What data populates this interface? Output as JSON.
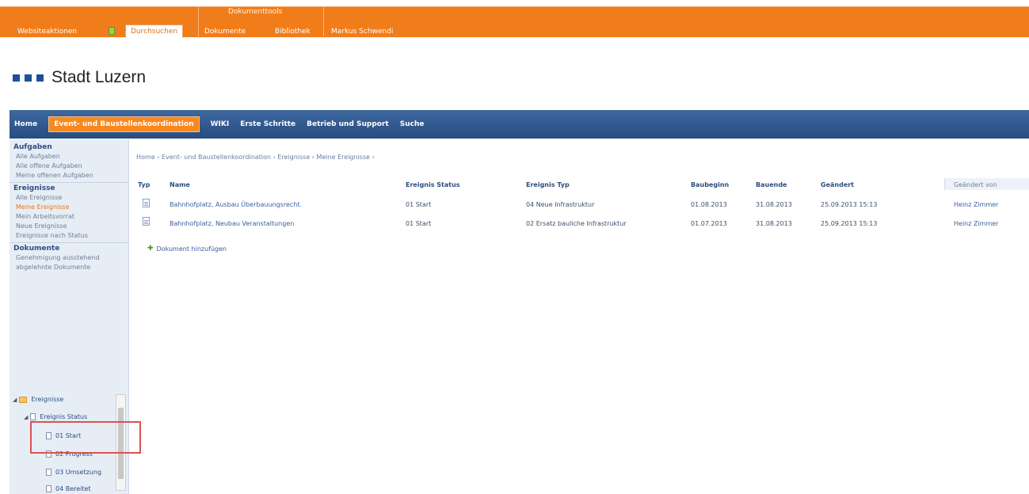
{
  "ribbon": {
    "group_label": "Dokumenttools",
    "tabs": [
      {
        "label": "Websiteaktionen"
      },
      {
        "label": "Durchsuchen"
      },
      {
        "label": "Dokumente"
      },
      {
        "label": "Bibliothek"
      }
    ],
    "user": "Markus Schwendi",
    "colors": {
      "bar": "#f07d1a",
      "accent": "#ffffff"
    }
  },
  "site": {
    "title": "Stadt Luzern",
    "logo_squares": 3,
    "logo_color": "#1e4f99"
  },
  "topnav": {
    "items": [
      {
        "label": "Home",
        "active": false
      },
      {
        "label": "Event- und Baustellenkoordination",
        "active": true
      },
      {
        "label": "WIKI",
        "active": false
      },
      {
        "label": "Erste Schritte",
        "active": false
      },
      {
        "label": "Betrieb und Support",
        "active": false
      },
      {
        "label": "Suche",
        "active": false
      }
    ]
  },
  "leftnav": {
    "sections": [
      {
        "heading": "Aufgaben",
        "items": [
          "Alle Aufgaben",
          "Alle offene Aufgaben",
          "Meine offenen Aufgaben"
        ]
      },
      {
        "heading": "Ereignisse",
        "items": [
          "Alle Ereignisse",
          "Meine Ereignisse",
          "Mein Arbeitsvorrat",
          "Neue Ereignisse",
          "Ereignisse nach Status"
        ],
        "selected_index": 1
      },
      {
        "heading": "Dokumente",
        "items": [
          "Genehmigung ausstehend",
          "abgelehnte Dokumente"
        ]
      }
    ],
    "tree": {
      "root": "Ereignisse",
      "child": "Ereignis Status",
      "leaves": [
        "01 Start",
        "02 Progress",
        "03 Umsetzung",
        "04 Bereitet"
      ],
      "highlighted_leaf": "01 Start"
    }
  },
  "main": {
    "breadcrumb": "Home › Event- und Baustellenkoordination › Ereignisse › Meine Ereignisse ›",
    "columns": [
      "Typ",
      "Name",
      "Ereignis Status",
      "Ereignis Typ",
      "Baubeginn",
      "Bauende",
      "Geändert",
      "Geändert von"
    ],
    "rows": [
      {
        "name": "Bahnhofplatz, Ausbau Überbauungsrecht.",
        "status": "01 Start",
        "type": "04 Neue Infrastruktur",
        "start": "01.08.2013",
        "end": "31.08.2013",
        "modified": "25.09.2013 15:13",
        "modified_by": "Heinz Zimmer"
      },
      {
        "name": "Bahnhofplatz, Neubau Veranstaltungen",
        "status": "01 Start",
        "type": "02 Ersatz bauliche Infrastruktur",
        "start": "01.07.2013",
        "end": "31.08.2013",
        "modified": "25.09.2013 15:13",
        "modified_by": "Heinz Zimmer"
      }
    ],
    "add_document": "Dokument hinzufügen"
  }
}
